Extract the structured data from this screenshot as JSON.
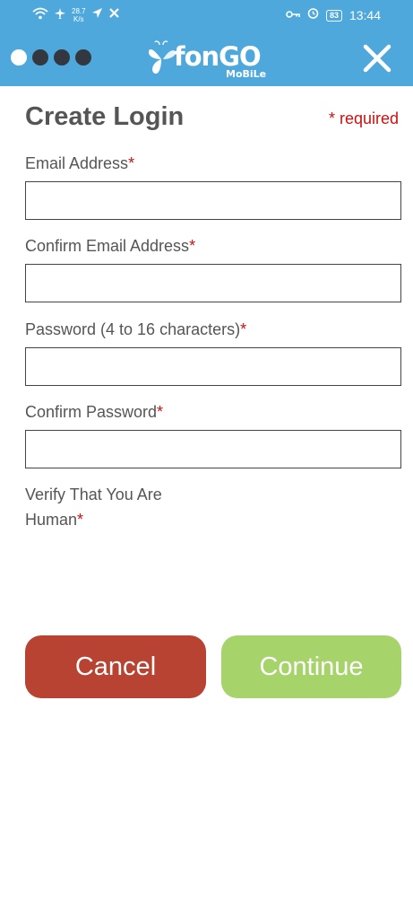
{
  "status_bar": {
    "net_speed_value": "28.7",
    "net_speed_unit": "K/s",
    "battery": "83",
    "time": "13:44"
  },
  "header": {
    "logo_text": "fonGO",
    "logo_sub": "MoBiLe",
    "progress_steps_total": 4,
    "progress_step_current": 1,
    "colors": {
      "bar": "#4fa8dc",
      "dot_active": "#ffffff",
      "dot_inactive": "#333840"
    }
  },
  "form": {
    "title": "Create Login",
    "required_note": "* required",
    "required_marker": "*",
    "fields": {
      "email_label": "Email Address",
      "confirm_email_label": "Confirm Email Address",
      "password_label": "Password (4 to 16 characters)",
      "confirm_password_label": "Confirm Password",
      "email_value": "",
      "confirm_email_value": "",
      "password_value": "",
      "confirm_password_value": ""
    },
    "verify_label_line1": "Verify That You Are",
    "verify_label_line2": "Human"
  },
  "buttons": {
    "cancel_label": "Cancel",
    "continue_label": "Continue",
    "cancel_color": "#b84333",
    "continue_color": "#a6d36a"
  }
}
